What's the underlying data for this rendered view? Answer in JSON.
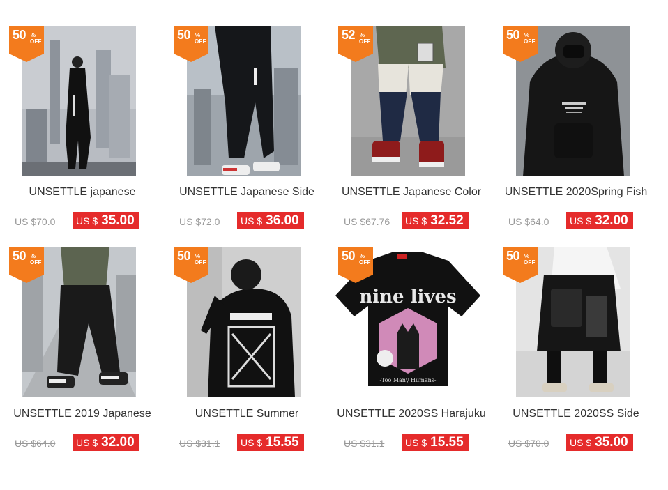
{
  "products": [
    {
      "title": "UNSETTLE japanese",
      "old_price": "US $70.0",
      "currency": "US $",
      "price": "35.00",
      "discount": "50",
      "discount_symbol": "%",
      "discount_label": "OFF",
      "image": "man-in-black-trench-coat-on-rooftop-image"
    },
    {
      "title": "UNSETTLE Japanese Side",
      "old_price": "US $72.0",
      "currency": "US $",
      "price": "36.00",
      "discount": "50",
      "discount_symbol": "%",
      "discount_label": "OFF",
      "image": "black-cargo-pants-with-sneakers-image"
    },
    {
      "title": "UNSETTLE Japanese Color",
      "old_price": "US $67.76",
      "currency": "US $",
      "price": "32.52",
      "discount": "52",
      "discount_symbol": "%",
      "discount_label": "OFF",
      "image": "color-block-cargo-pants-image"
    },
    {
      "title": "UNSETTLE 2020Spring Fish",
      "old_price": "US $64.0",
      "currency": "US $",
      "price": "32.00",
      "discount": "50",
      "discount_symbol": "%",
      "discount_label": "OFF",
      "image": "black-hoodie-with-mask-image"
    },
    {
      "title": "UNSETTLE 2019 Japanese",
      "old_price": "US $64.0",
      "currency": "US $",
      "price": "32.00",
      "discount": "50",
      "discount_symbol": "%",
      "discount_label": "OFF",
      "image": "black-joggers-on-walkway-image"
    },
    {
      "title": "UNSETTLE Summer",
      "old_price": "US $31.1",
      "currency": "US $",
      "price": "15.55",
      "discount": "50",
      "discount_symbol": "%",
      "discount_label": "OFF",
      "image": "black-tee-arrow-print-back-image"
    },
    {
      "title": "UNSETTLE 2020SS Harajuku",
      "old_price": "US $31.1",
      "currency": "US $",
      "price": "15.55",
      "discount": "50",
      "discount_symbol": "%",
      "discount_label": "OFF",
      "image": "nine-lives-cat-tshirt-image",
      "print_text": "nine lives",
      "print_subtext": "-Too Many Humans-"
    },
    {
      "title": "UNSETTLE 2020SS Side",
      "old_price": "US $70.0",
      "currency": "US $",
      "price": "35.00",
      "discount": "50",
      "discount_symbol": "%",
      "discount_label": "OFF",
      "image": "layered-skirt-pants-image"
    }
  ],
  "colors": {
    "badge": "#f37b1d",
    "price_tag": "#e52b2b"
  }
}
